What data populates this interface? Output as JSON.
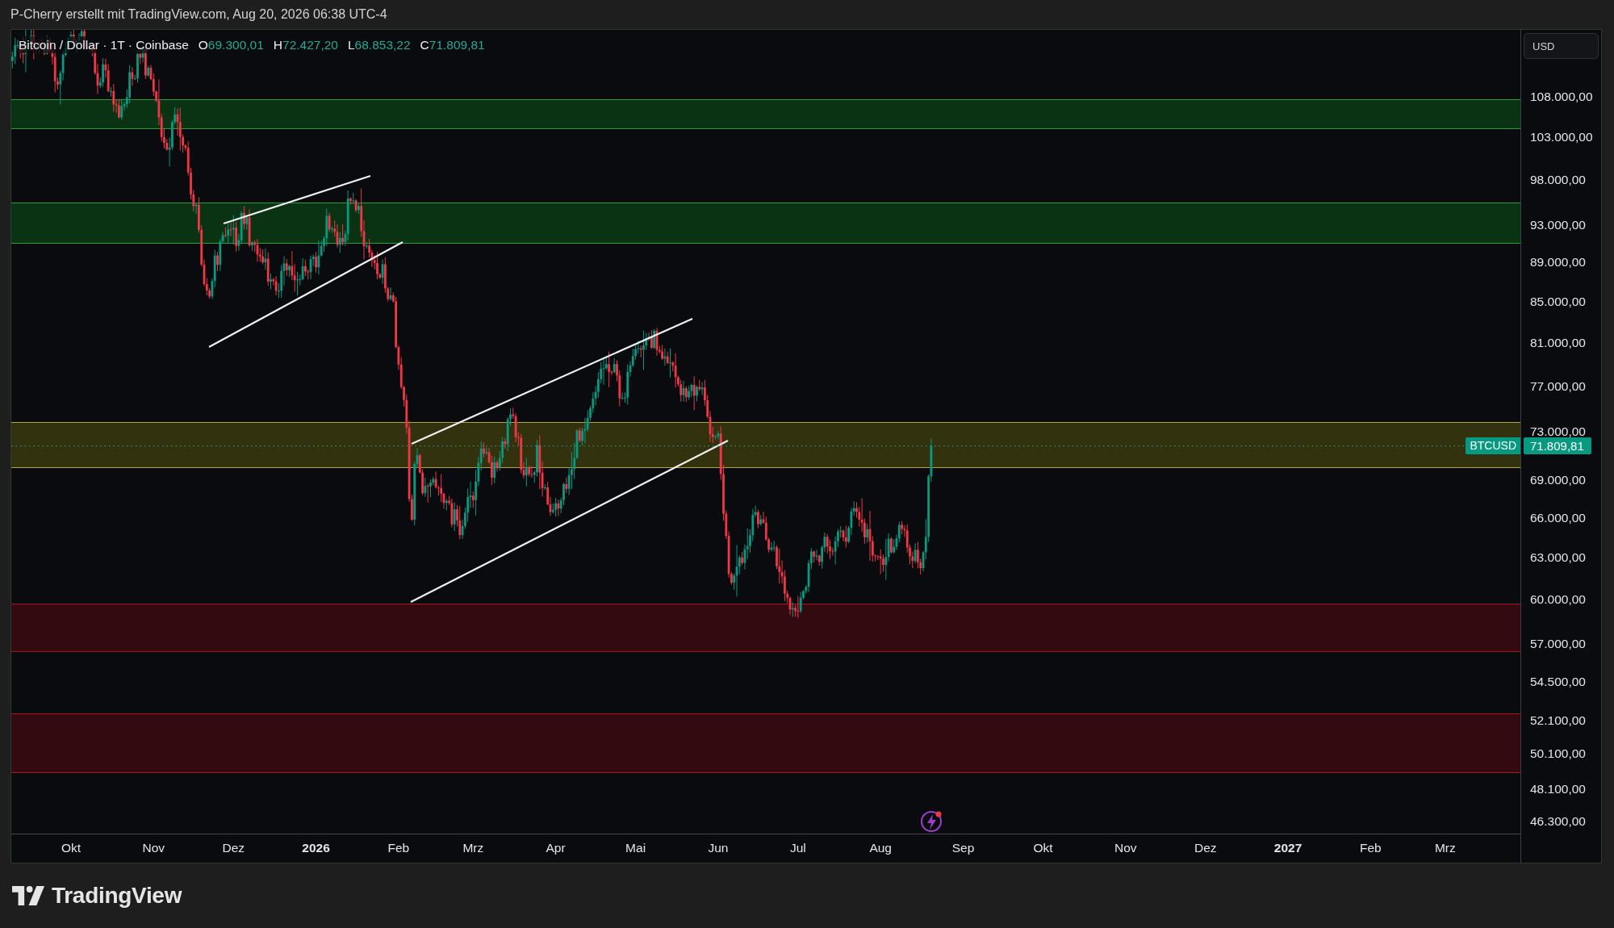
{
  "header": {
    "caption": "P-Cherry erstellt mit TradingView.com, Aug 20, 2026 06:38 UTC-4"
  },
  "legend": {
    "title": "Bitcoin / Dollar · 1T · Coinbase",
    "ohlc": [
      {
        "key": "O",
        "value": "69.300,01"
      },
      {
        "key": "H",
        "value": "72.427,20"
      },
      {
        "key": "L",
        "value": "68.853,22"
      },
      {
        "key": "C",
        "value": "71.809,81"
      }
    ]
  },
  "price_axis": {
    "currency_button": "USD",
    "labels": [
      "108.000,00",
      "103.000,00",
      "98.000,00",
      "93.000,00",
      "89.000,00",
      "85.000,00",
      "81.000,00",
      "77.000,00",
      "73.000,00",
      "69.000,00",
      "66.000,00",
      "63.000,00",
      "60.000,00",
      "57.000,00",
      "54.500,00",
      "52.100,00",
      "50.100,00",
      "48.100,00",
      "46.300,00"
    ],
    "last_price": "71.809,81"
  },
  "price_tag": {
    "symbol": "BTCUSD"
  },
  "time_axis": {
    "labels": [
      {
        "label": "Okt",
        "kind": "month"
      },
      {
        "label": "Nov",
        "kind": "month"
      },
      {
        "label": "Dez",
        "kind": "month"
      },
      {
        "label": "2026",
        "kind": "year"
      },
      {
        "label": "Feb",
        "kind": "month"
      },
      {
        "label": "Mrz",
        "kind": "month"
      },
      {
        "label": "Apr",
        "kind": "month"
      },
      {
        "label": "Mai",
        "kind": "month"
      },
      {
        "label": "Jun",
        "kind": "month"
      },
      {
        "label": "Jul",
        "kind": "month"
      },
      {
        "label": "Aug",
        "kind": "month"
      },
      {
        "label": "Sep",
        "kind": "month"
      },
      {
        "label": "Okt",
        "kind": "month"
      },
      {
        "label": "Nov",
        "kind": "month"
      },
      {
        "label": "Dez",
        "kind": "month"
      },
      {
        "label": "2027",
        "kind": "year"
      },
      {
        "label": "Feb",
        "kind": "month"
      },
      {
        "label": "Mrz",
        "kind": "month"
      }
    ]
  },
  "footer": {
    "brand": "TradingView"
  }
}
